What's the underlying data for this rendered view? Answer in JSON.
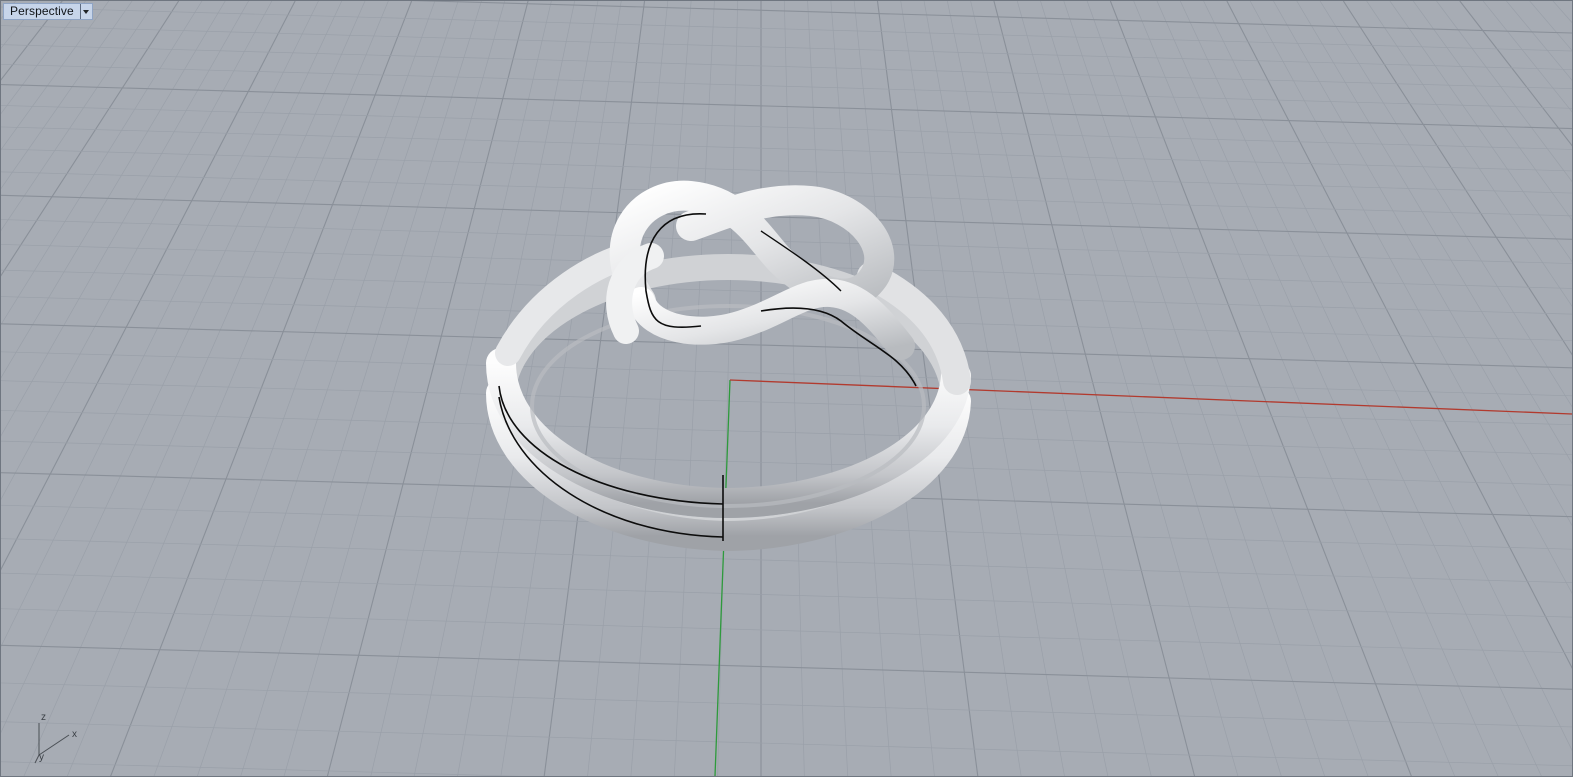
{
  "viewport": {
    "title": "Perspective",
    "menu_icon": "chevron-down-icon"
  },
  "axis_widget": {
    "z_label": "z",
    "x_label": "x",
    "y_label": "y"
  },
  "colors": {
    "background": "#a7acb4",
    "grid_minor": "#9aa0a9",
    "grid_major": "#8a9099",
    "x_axis": "#b23a2e",
    "y_axis": "#2e9a3c",
    "model_light": "#f2f2f2",
    "model_shadow": "#9a9da2",
    "edge": "#0c0c0c"
  },
  "model": {
    "name": "knot-ring"
  }
}
